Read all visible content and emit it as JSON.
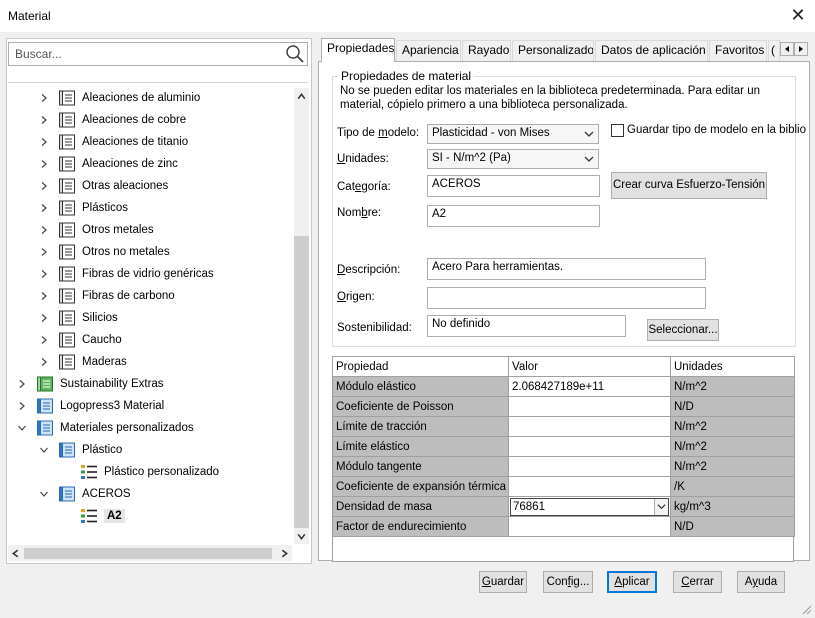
{
  "window": {
    "title": "Material"
  },
  "search": {
    "placeholder": "Buscar..."
  },
  "tree": [
    {
      "label": "Aleaciones de aluminio",
      "level": 1,
      "icon": "library"
    },
    {
      "label": "Aleaciones de cobre",
      "level": 1,
      "icon": "library"
    },
    {
      "label": "Aleaciones de titanio",
      "level": 1,
      "icon": "library"
    },
    {
      "label": "Aleaciones de zinc",
      "level": 1,
      "icon": "library"
    },
    {
      "label": "Otras aleaciones",
      "level": 1,
      "icon": "library"
    },
    {
      "label": "Plásticos",
      "level": 1,
      "icon": "library"
    },
    {
      "label": "Otros metales",
      "level": 1,
      "icon": "library"
    },
    {
      "label": "Otros no metales",
      "level": 1,
      "icon": "library"
    },
    {
      "label": "Fibras de vidrio genéricas",
      "level": 1,
      "icon": "library"
    },
    {
      "label": "Fibras de carbono",
      "level": 1,
      "icon": "library"
    },
    {
      "label": "Silicios",
      "level": 1,
      "icon": "library"
    },
    {
      "label": "Caucho",
      "level": 1,
      "icon": "library"
    },
    {
      "label": "Maderas",
      "level": 1,
      "icon": "library"
    },
    {
      "label": "Sustainability Extras",
      "level": 0,
      "icon": "library-green"
    },
    {
      "label": "Logopress3 Material",
      "level": 0,
      "icon": "library-blue"
    },
    {
      "label": "Materiales personalizados",
      "level": 0,
      "icon": "library-blue",
      "expanded": true
    },
    {
      "label": "Plástico",
      "level": 1,
      "icon": "library-blue",
      "expanded": true
    },
    {
      "label": "Plástico personalizado",
      "level": 2,
      "icon": "material"
    },
    {
      "label": "ACEROS",
      "level": 1,
      "icon": "library-blue",
      "expanded": true
    },
    {
      "label": "A2",
      "level": 2,
      "icon": "material",
      "selected": true
    }
  ],
  "tabs": [
    "Propiedades",
    "Apariencia",
    "Rayado",
    "Personalizado",
    "Datos de aplicación",
    "Favoritos",
    "("
  ],
  "props": {
    "group_title": "Propiedades de material",
    "info": "No se pueden editar los materiales en la biblioteca predeterminada. Para editar un material, cópielo primero a una biblioteca personalizada.",
    "model_type_label": "Tipo de modelo:",
    "model_type_value": "Plasticidad - von Mises",
    "save_model_type_label": "Guardar tipo de modelo en la biblio",
    "units_label": "Unidades:",
    "units_value": "SI - N/m^2 (Pa)",
    "category_label": "Categoría:",
    "category_value": "ACEROS",
    "stress_curve_button": "Crear curva Esfuerzo-Tensión",
    "name_label": "Nombre:",
    "name_value": "A2",
    "description_label": "Descripción:",
    "description_value": "Acero Para herramientas.",
    "origin_label": "Origen:",
    "origin_value": "",
    "sustainability_label": "Sostenibilidad:",
    "sustainability_value": "No definido",
    "select_button": "Seleccionar..."
  },
  "table": {
    "headers": [
      "Propiedad",
      "Valor",
      "Unidades"
    ],
    "rows": [
      {
        "name": "Módulo elástico",
        "value": "2.068427189e+11",
        "unit": "N/m^2"
      },
      {
        "name": "Coeficiente de Poisson",
        "value": "",
        "unit": "N/D"
      },
      {
        "name": "Límite de tracción",
        "value": "",
        "unit": "N/m^2"
      },
      {
        "name": "Límite elástico",
        "value": "",
        "unit": "N/m^2"
      },
      {
        "name": "Módulo tangente",
        "value": "",
        "unit": "N/m^2"
      },
      {
        "name": "Coeficiente de expansión térmica",
        "value": "",
        "unit": "/K"
      },
      {
        "name": "Densidad de masa",
        "value": "76861",
        "unit": "kg/m^3",
        "editing": true
      },
      {
        "name": "Factor de endurecimiento",
        "value": "",
        "unit": "N/D"
      }
    ]
  },
  "buttons": {
    "save": "Guardar",
    "config": "Config...",
    "apply": "Aplicar",
    "close": "Cerrar",
    "help": "Ayuda"
  },
  "colors": {
    "accent": "#0078d7",
    "grid_gray": "#bdbdbd",
    "library_green": "#3a9b3a",
    "library_blue": "#2a78c8"
  }
}
